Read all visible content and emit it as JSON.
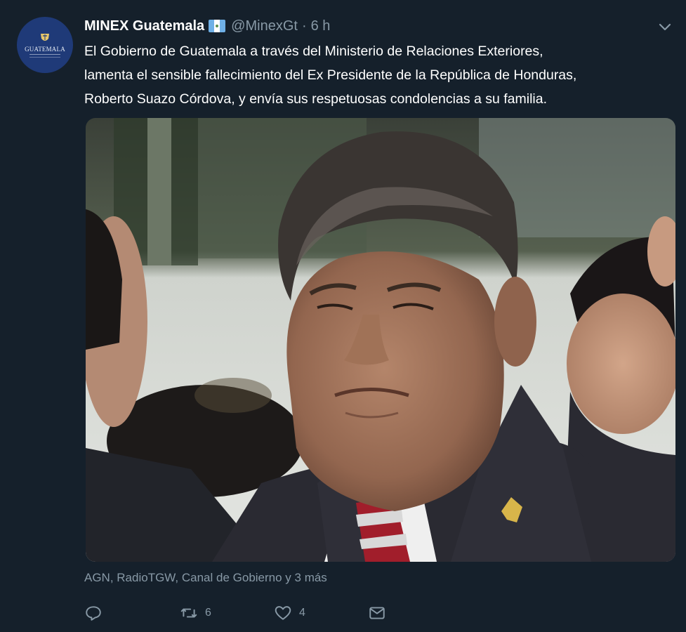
{
  "tweet": {
    "author_name": "MINEX Guatemala",
    "handle": "@MinexGt",
    "separator": "·",
    "time": "6 h",
    "avatar_text": "GUATEMALA",
    "text_lines": [
      "El Gobierno de Guatemala a través del Ministerio de Relaciones Exteriores,",
      "lamenta el sensible fallecimiento del Ex Presidente de la República de Honduras,",
      "Roberto Suazo Córdova, y envía sus respetuosas condolencias a su familia."
    ],
    "media_attribution": "AGN, RadioTGW, Canal de Gobierno y 3 más"
  },
  "actions": {
    "reply": {
      "icon": "reply-icon",
      "count": ""
    },
    "retweet": {
      "icon": "retweet-icon",
      "count": "6"
    },
    "like": {
      "icon": "heart-icon",
      "count": "4"
    },
    "message": {
      "icon": "envelope-icon",
      "count": ""
    }
  },
  "colors": {
    "background": "#15202b",
    "text": "#ffffff",
    "secondary": "#8899a6",
    "avatar": "#1f3a78"
  }
}
